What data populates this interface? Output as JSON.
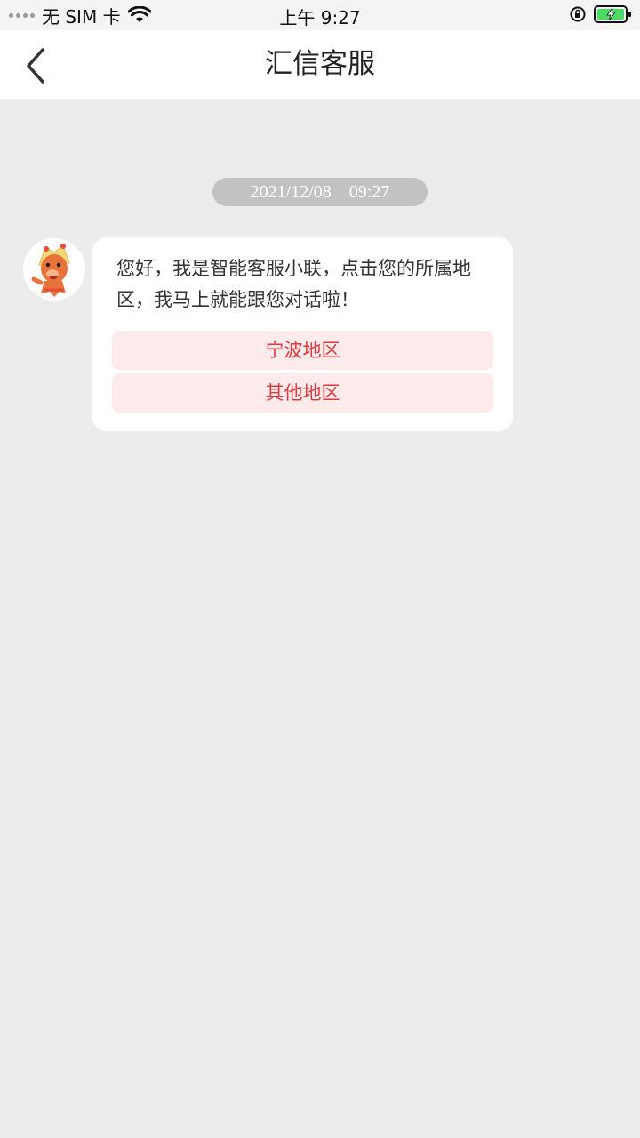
{
  "status_bar": {
    "carrier": "无 SIM 卡",
    "time": "上午 9:27"
  },
  "header": {
    "title": "汇信客服"
  },
  "chat": {
    "timestamp": "2021/12/08　09:27",
    "message": "您好，我是智能客服小联，点击您的所属地区，我马上就能跟您对话啦！",
    "options": [
      {
        "label": "宁波地区"
      },
      {
        "label": "其他地区"
      }
    ]
  },
  "colors": {
    "accent": "#e03a3a",
    "option_bg": "#fdeaea",
    "page_bg": "#ececec",
    "battery_green": "#4cd964"
  }
}
